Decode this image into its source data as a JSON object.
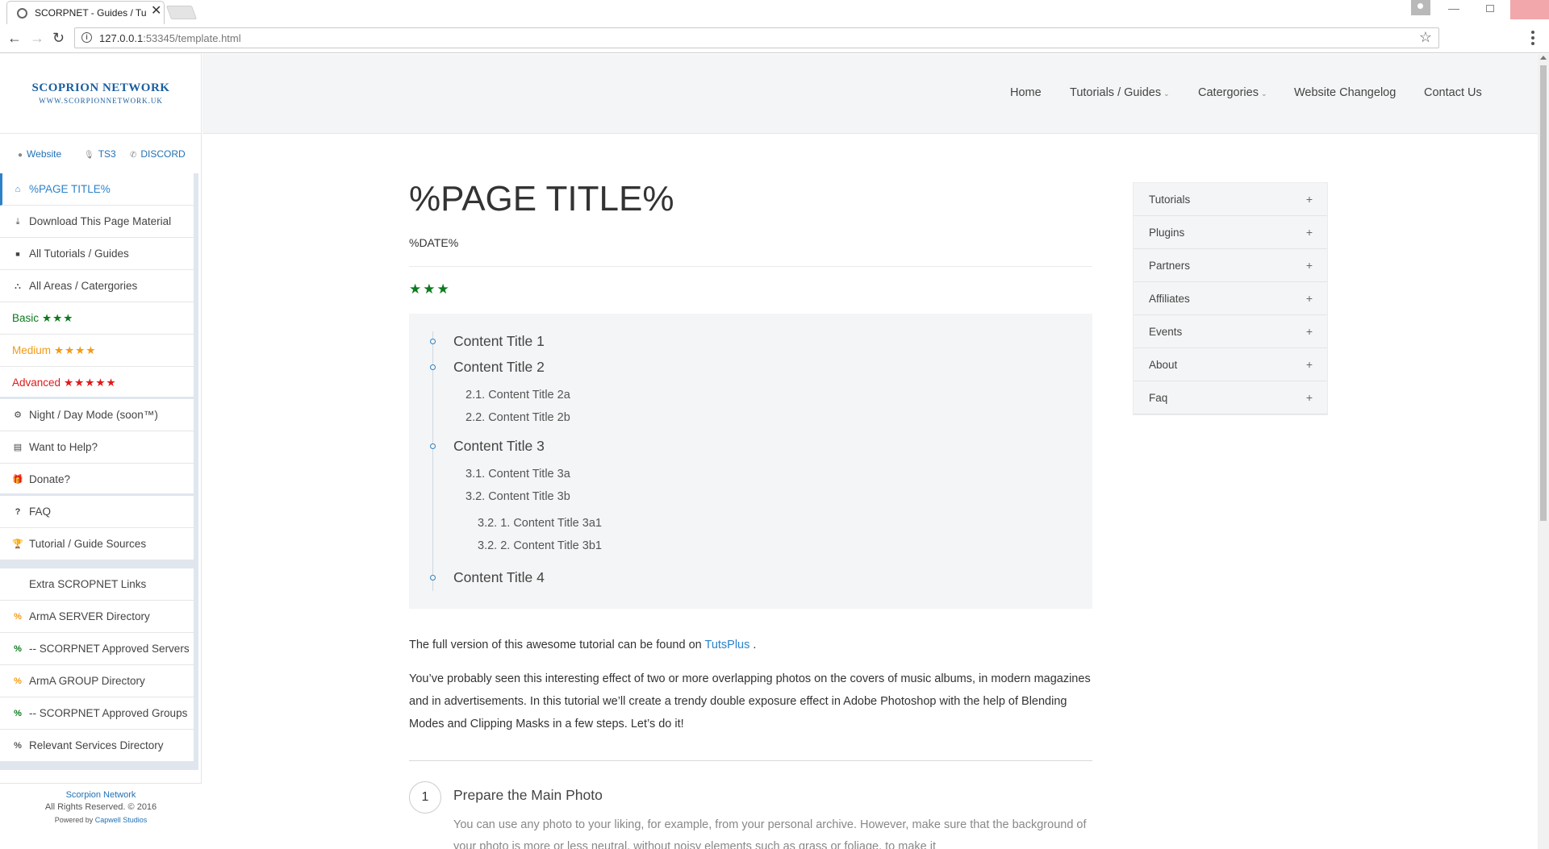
{
  "browser": {
    "tab_title": "SCORPNET - Guides / Tu",
    "url_host": "127.0.0.1",
    "url_port_path": ":53345/template.html",
    "close_glyph": "✕",
    "back_glyph": "←",
    "forward_glyph": "→",
    "reload_glyph": "↻",
    "bookmark_glyph": "☆",
    "min_glyph": "—"
  },
  "brand": {
    "name": "SCOPRION NETWORK",
    "url": "WWW.SCORPIONNETWORK.UK"
  },
  "quick_links": [
    {
      "label": "Website",
      "icon": "globe-icon",
      "glyph": "●"
    },
    {
      "label": "TS3",
      "icon": "microphone-icon",
      "glyph": "🎙"
    },
    {
      "label": "DISCORD",
      "icon": "phone-icon",
      "glyph": "✆"
    }
  ],
  "sidebar": {
    "items": [
      {
        "label": "%PAGE TITLE%",
        "icon": "home-icon",
        "glyph": "⌂"
      },
      {
        "label": "Download This Page Material",
        "icon": "download-icon",
        "glyph": "⤓"
      },
      {
        "label": "All Tutorials / Guides",
        "icon": "folder-icon",
        "glyph": "■"
      },
      {
        "label": "All Areas / Catergories",
        "icon": "sitemap-icon",
        "glyph": "⛬"
      },
      {
        "label": "Basic",
        "stars": "★★★",
        "color": "#0d7a1e"
      },
      {
        "label": "Medium",
        "stars": "★★★★",
        "color": "#f39a17"
      },
      {
        "label": "Advanced",
        "stars": "★★★★★",
        "color": "#e01a1a"
      },
      {
        "label": "Night / Day Mode (soon™)",
        "icon": "cogs-icon",
        "glyph": "⚙"
      },
      {
        "label": "Want to Help?",
        "icon": "book-icon",
        "glyph": "▤"
      },
      {
        "label": "Donate?",
        "icon": "gift-icon",
        "glyph": "🎁"
      },
      {
        "label": "FAQ",
        "icon": "question-icon",
        "glyph": "?"
      },
      {
        "label": "Tutorial / Guide Sources",
        "icon": "trophy-icon",
        "glyph": "🏆"
      }
    ],
    "extra_heading": "Extra SCROPNET Links",
    "links": [
      {
        "label": "ArmA SERVER Directory",
        "color": "#f39a17"
      },
      {
        "label": "-- SCORPNET Approved Servers",
        "color": "#0d7a1e"
      },
      {
        "label": "ArmA GROUP Directory",
        "color": "#f39a17"
      },
      {
        "label": "-- SCORPNET Approved Groups",
        "color": "#0d7a1e"
      },
      {
        "label": "Relevant Services Directory",
        "color": "#555555"
      }
    ],
    "link_glyph": "%",
    "footer": {
      "name": "Scorpion Network",
      "rights": "All Rights Reserved. © 2016",
      "powered_prefix": "Powered by",
      "powered_by": "Capwell Studios"
    }
  },
  "topnav": [
    {
      "label": "Home",
      "caret": ""
    },
    {
      "label": "Tutorials / Guides",
      "caret": "⌄"
    },
    {
      "label": "Catergories",
      "caret": "⌄"
    },
    {
      "label": "Website Changelog",
      "caret": ""
    },
    {
      "label": "Contact Us",
      "caret": ""
    }
  ],
  "article": {
    "title": "%PAGE TITLE%",
    "date": "%DATE%",
    "rating_stars": "★★★",
    "toc": [
      {
        "level": 1,
        "text": "Content Title 1"
      },
      {
        "level": 1,
        "text": "Content Title 2"
      },
      {
        "level": 2,
        "text": "2.1. Content Title 2a"
      },
      {
        "level": 2,
        "text": "2.2. Content Title 2b"
      },
      {
        "level": 1,
        "text": "Content Title 3"
      },
      {
        "level": 2,
        "text": "3.1. Content Title 3a"
      },
      {
        "level": 2,
        "text": "3.2. Content Title 3b"
      },
      {
        "level": 3,
        "text": "3.2. 1. Content Title 3a1"
      },
      {
        "level": 3,
        "text": "3.2. 2. Content Title 3b1"
      },
      {
        "level": 1,
        "text": "Content Title 4"
      }
    ],
    "intro_prefix": "The full version of this awesome tutorial can be found on",
    "intro_link": "TutsPlus",
    "intro_suffix": ".",
    "paragraph": "You’ve probably seen this interesting effect of two or more overlapping photos on the covers of music albums, in modern magazines and in advertisements. In this tutorial we’ll create a trendy double exposure effect in Adobe Photoshop with the help of Blending Modes and Clipping Masks in a few steps. Let’s do it!",
    "step": {
      "number": "1",
      "title": "Prepare the Main Photo",
      "text": "You can use any photo to your liking, for example, from your personal archive. However, make sure that the background of your photo is more or less neutral, without noisy elements such as grass or foliage, to make it"
    }
  },
  "widget": {
    "items": [
      "Tutorials",
      "Plugins",
      "Partners",
      "Affiliates",
      "Events",
      "About",
      "Faq"
    ],
    "plus": "+"
  }
}
